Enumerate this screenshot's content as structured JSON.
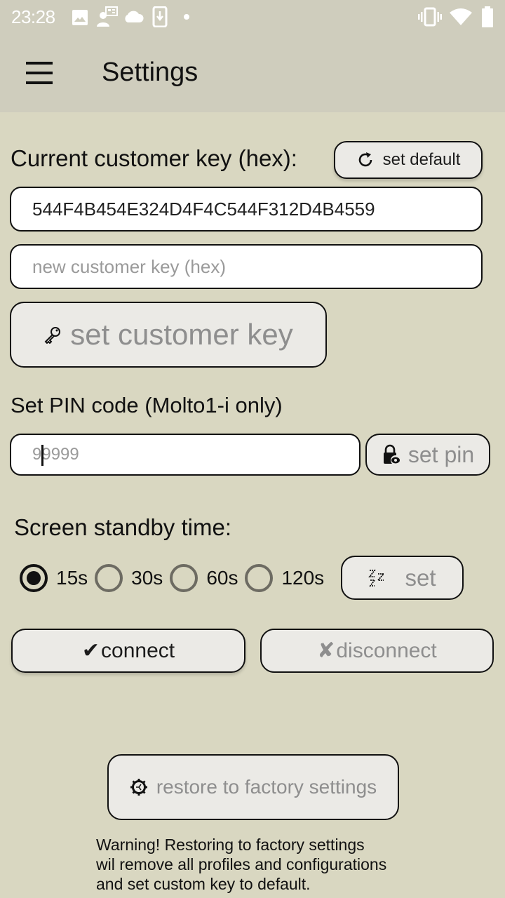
{
  "status_bar": {
    "time": "23:28",
    "left_icons": [
      "image-icon",
      "contact-card-icon",
      "cloud-icon",
      "phone-download-icon",
      "dot-icon"
    ],
    "right_icons": [
      "vibrate-icon",
      "wifi-icon",
      "battery-icon"
    ]
  },
  "app_bar": {
    "menu_icon": "hamburger-menu-icon",
    "title": "Settings"
  },
  "customer_key": {
    "label": "Current customer key (hex):",
    "set_default_label": "set default",
    "set_default_icon": "refresh-icon",
    "current_value": "544F4B454E324D4F4C544F312D4B4559",
    "new_key_placeholder": "new customer key (hex)",
    "new_key_value": "",
    "set_button_label": "set customer key",
    "set_button_icon": "key-icon"
  },
  "pin": {
    "label": "Set PIN code (Molto1-i only)",
    "placeholder": "99999",
    "value": "",
    "set_button_label": "set pin",
    "set_button_icon": "lock-eye-icon"
  },
  "standby": {
    "label": "Screen standby time:",
    "options": [
      {
        "label": "15s",
        "checked": true
      },
      {
        "label": "30s",
        "checked": false
      },
      {
        "label": "60s",
        "checked": false
      },
      {
        "label": "120s",
        "checked": false
      }
    ],
    "set_button_label": "set",
    "set_button_icon": "sleep-zzz-icon"
  },
  "connection": {
    "connect_label": "connect",
    "connect_icon": "✔",
    "disconnect_label": "disconnect",
    "disconnect_icon": "✘"
  },
  "factory": {
    "button_label": "restore to factory settings",
    "button_icon": "gear-icon",
    "warning": "Warning! Restoring to factory settings wil remove all profiles and configurations and set custom key to default.",
    "warning_lines": [
      "Warning! Restoring to factory settings",
      "wil remove all profiles and configurations",
      "and set custom key to default."
    ]
  },
  "colors": {
    "background": "#d9d7c1",
    "app_bar": "#cfcdbd",
    "button_face": "#ebeae6",
    "disabled_text": "#8e8e8e"
  }
}
